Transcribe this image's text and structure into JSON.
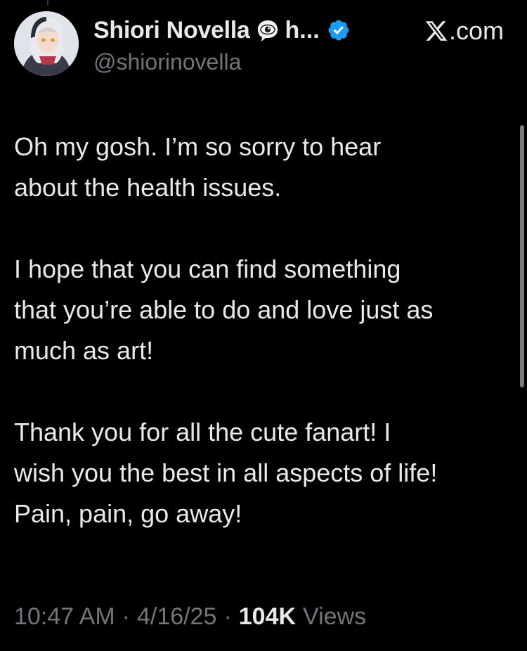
{
  "author": {
    "display_name": "Shiori Novella",
    "name_suffix": "h...",
    "name_emoji_icon": "eye-in-speech-bubble-icon",
    "verified_icon": "verified-badge-icon",
    "verified_color": "#1d9bf0",
    "handle": "@shiorinovella",
    "avatar_icon": "avatar"
  },
  "source": {
    "logo_icon": "x-logo-icon",
    "label": ".com"
  },
  "tweet": {
    "paragraphs": [
      "Oh my gosh. I’m so sorry to hear\nabout the health issues.",
      "I hope that you can find something\nthat you’re able to do and love just as\nmuch as art!",
      "Thank you for all the cute fanart! I\nwish you the best in all aspects of life!\nPain, pain, go away!"
    ]
  },
  "meta": {
    "time": "10:47 AM",
    "separator": "·",
    "date": "4/16/25",
    "views_count": "104K",
    "views_label": "Views"
  },
  "colors": {
    "background": "#000000",
    "primary_text": "#e7e9ea",
    "secondary_text": "#71767b"
  }
}
